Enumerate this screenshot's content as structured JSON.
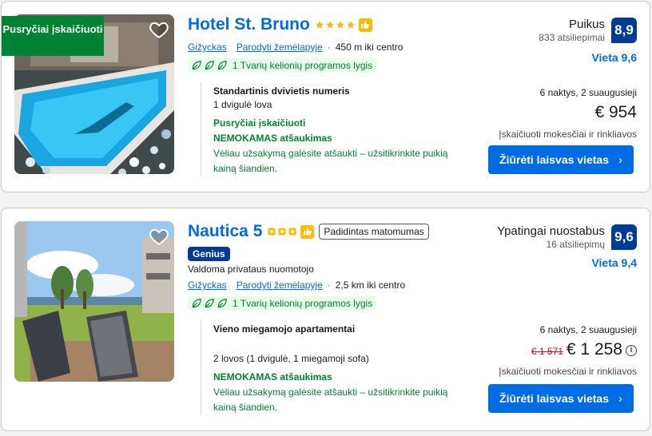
{
  "colors": {
    "brand_blue": "#006ce4",
    "score_blue": "#003b95",
    "green": "#008234",
    "star_yellow": "#febb02",
    "strike_red": "#d4111e"
  },
  "icons": [
    "heart-icon",
    "star-icon",
    "thumbs-up-icon",
    "leaf-icon",
    "chevron-right-icon",
    "info-icon"
  ],
  "listings": [
    {
      "ribbon": "Pusryčiai įskaičiuoti",
      "name": "Hotel St. Bruno",
      "stars": 4,
      "badge": "",
      "genius": "",
      "managed": "",
      "city": "Gižyckas",
      "map_link": "Parodyti žemėlapyje",
      "distance": "450 m iki centro",
      "sustainability": "1 Tvarių kelionių programos lygis",
      "room_type": "Standartinis dvivietis numeris",
      "beds": "1 dvigulė lova",
      "breakfast": "Pusryčiai įskaičiuoti",
      "cancellation": "NEMOKAMAS atšaukimas",
      "cancel_note": "Vėliau užsakymą galėsite atšaukti – užsitikrinkite puikią kainą šiandien.",
      "score_word": "Puikus",
      "reviews": "833 atsiliepimai",
      "score": "8,9",
      "location_score": "Vieta 9,6",
      "stay": "6 naktys, 2 suaugusieji",
      "old_price": "",
      "price": "€ 954",
      "taxes": "Įskaičiuoti mokesčiai ir rinkliavos",
      "cta": "Žiūrėti laisvas vietas"
    },
    {
      "ribbon": "",
      "name": "Nautica 5",
      "stars": 3,
      "badge": "Padidintas matomumas",
      "genius": "Genius",
      "managed": "Valdoma privataus nuomotojo",
      "city": "Gižyckas",
      "map_link": "Parodyti žemėlapyje",
      "distance": "2,5 km iki centro",
      "sustainability": "1 Tvarių kelionių programos lygis",
      "room_type": "Vieno miegamojo apartamentai",
      "beds": "2 lovos (1 dvigulė, 1 miegamoji sofa)",
      "breakfast": "",
      "cancellation": "NEMOKAMAS atšaukimas",
      "cancel_note": "Vėliau užsakymą galėsite atšaukti – užsitikrinkite puikią kainą šiandien.",
      "score_word": "Ypatingai nuostabus",
      "reviews": "16 atsiliepimų",
      "score": "9,6",
      "location_score": "Vieta 9,4",
      "stay": "6 naktys, 2 suaugusieji",
      "old_price": "€ 1 571",
      "price": "€ 1 258",
      "taxes": "Įskaičiuoti mokesčiai ir rinkliavos",
      "cta": "Žiūrėti laisvas vietas"
    }
  ]
}
